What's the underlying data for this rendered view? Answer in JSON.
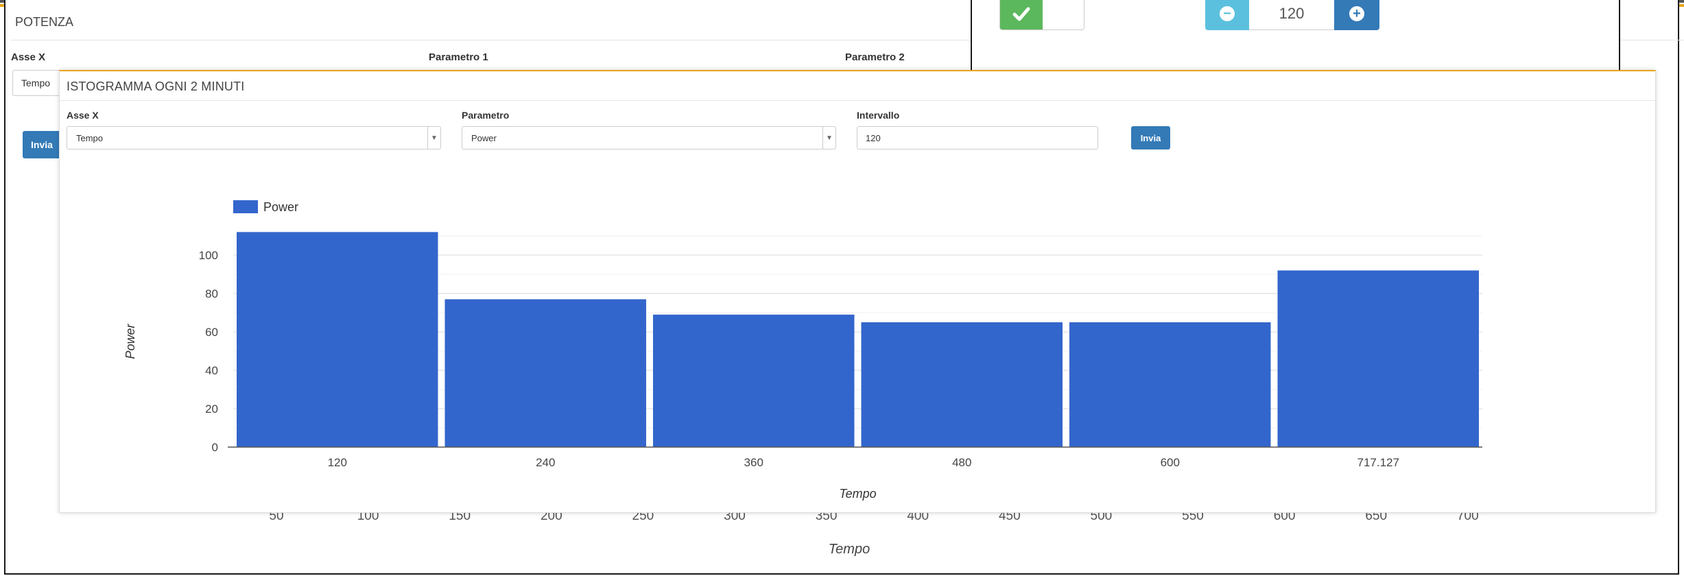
{
  "background": {
    "title": "POTENZA",
    "labels": {
      "axis_x": "Asse X",
      "param1": "Parametro 1",
      "param2": "Parametro 2"
    },
    "axis_x_select_value": "Tempo",
    "submit_label": "Invia",
    "x_ticks": [
      "50",
      "100",
      "150",
      "200",
      "250",
      "300",
      "350",
      "400",
      "450",
      "500",
      "550",
      "600",
      "650",
      "700"
    ],
    "x_axis_title": "Tempo"
  },
  "controls": {
    "toggle_state": "on",
    "stepper_value": "120"
  },
  "histogram": {
    "title": "ISTOGRAMMA OGNI 2 MINUTI",
    "form": {
      "axis_x_label": "Asse X",
      "axis_x_value": "Tempo",
      "param_label": "Parametro",
      "param_value": "Power",
      "interval_label": "Intervallo",
      "interval_value": "120",
      "submit_label": "Invia"
    }
  },
  "colors": {
    "bar": "#3366cc",
    "primary": "#337ab7",
    "success": "#5cb85c",
    "info": "#5bc0de",
    "accent": "#e8a61b"
  },
  "icons": {
    "toggle": "check-icon",
    "minus": "minus-circle-icon",
    "plus": "plus-circle-icon",
    "caret": "caret-down-icon"
  },
  "chart_data": {
    "type": "bar",
    "categories": [
      "120",
      "240",
      "360",
      "480",
      "600",
      "717.127"
    ],
    "series": [
      {
        "name": "Power",
        "values": [
          112,
          77,
          69,
          65,
          65,
          92
        ]
      }
    ],
    "xlabel": "Tempo",
    "ylabel": "Power",
    "ylim": [
      0,
      110
    ],
    "yticks": [
      0,
      20,
      40,
      60,
      80,
      100
    ],
    "legend": "top-left",
    "grid": true
  }
}
